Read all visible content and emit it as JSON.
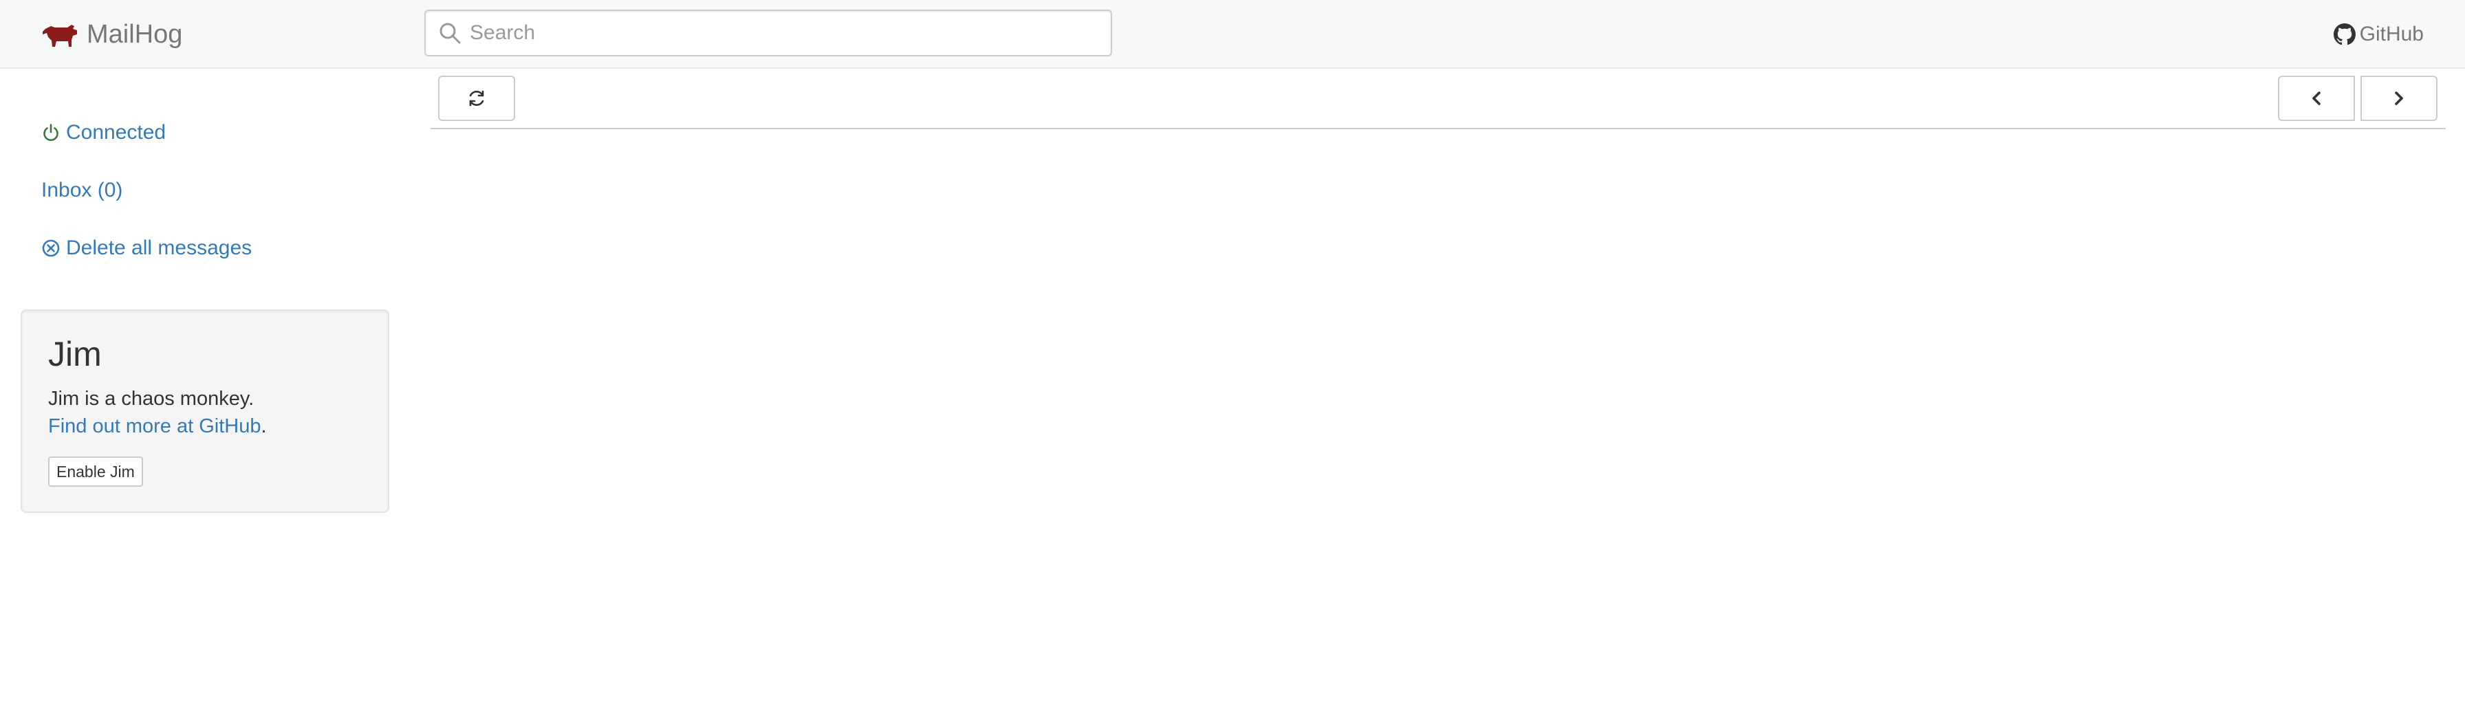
{
  "navbar": {
    "brand": "MailHog",
    "logo_icon": "pig-logo-icon",
    "search_placeholder": "Search",
    "search_value": "",
    "github_label": "GitHub"
  },
  "sidebar": {
    "connected_label": "Connected",
    "inbox_label": "Inbox (0)",
    "delete_all_label": "Delete all messages"
  },
  "jim": {
    "title": "Jim",
    "description": "Jim is a chaos monkey.",
    "more_link": "Find out more at GitHub",
    "more_suffix": ".",
    "button_label": "Enable Jim"
  },
  "toolbar": {
    "refresh_icon": "refresh-icon",
    "prev_icon": "chevron-left-icon",
    "next_icon": "chevron-right-icon"
  },
  "colors": {
    "link": "#337ab7",
    "connected": "#3c763d",
    "brand_logo": "#8b1c1c",
    "navbar_bg": "#f8f8f8",
    "panel_bg": "#f5f5f5"
  }
}
